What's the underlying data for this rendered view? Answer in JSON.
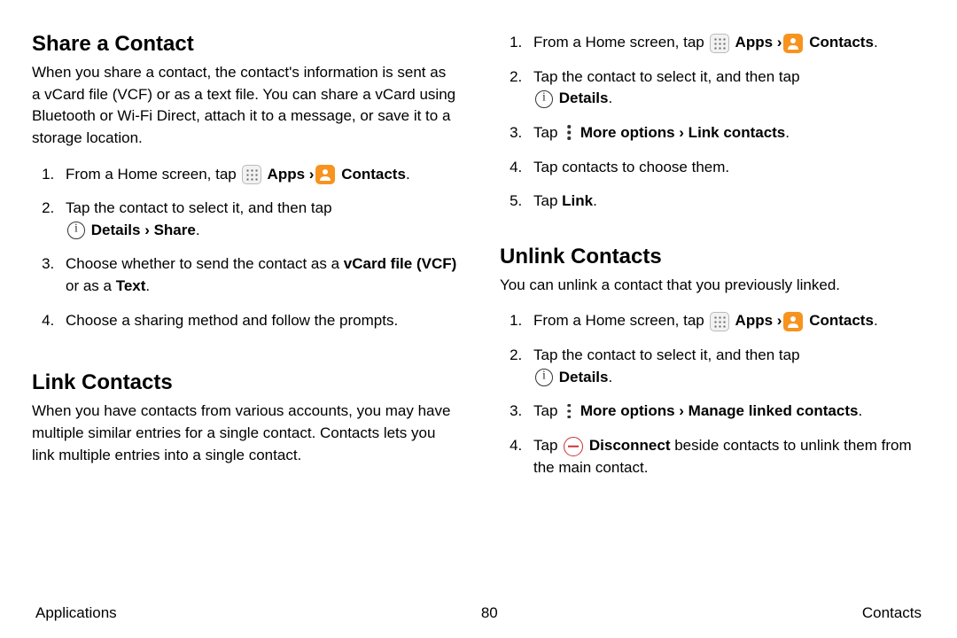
{
  "left": {
    "h1": "Share a Contact",
    "p1": "When you share a contact, the contact's information is sent as a vCard file (VCF) or as a text file. You can share a vCard using Bluetooth or Wi-Fi Direct, attach it to a message, or save it to a storage location.",
    "s1": {
      "t1a": "From a Home screen, tap ",
      "apps": " Apps ",
      "chev": "›",
      "contacts": " Contacts",
      "dot": ".",
      "t2a": "Tap the contact to select it, and then tap ",
      "details_share": " Details › Share",
      "t3a": "Choose whether to send the contact as a ",
      "vcf": "vCard file (VCF)",
      "t3b": " or as a ",
      "text": "Text",
      "t4": "Choose a sharing method and follow the prompts."
    },
    "h2": "Link Contacts",
    "p2": "When you have contacts from various accounts, you may have multiple similar entries for a single contact. Contacts lets you link multiple entries into a single contact."
  },
  "right": {
    "s2": {
      "t1a": "From a Home screen, tap ",
      "apps": " Apps ",
      "chev": "›",
      "contacts": " Contacts",
      "dot": ".",
      "t2a": "Tap the contact to select it, and then tap ",
      "details": " Details",
      "t3a": "Tap ",
      "more_link": " More options › Link contacts",
      "t4": "Tap contacts to choose them.",
      "t5a": "Tap ",
      "link": "Link"
    },
    "h3": "Unlink Contacts",
    "p3": "You can unlink a contact that you previously linked.",
    "s3": {
      "t1a": "From a Home screen, tap ",
      "apps": " Apps ",
      "chev": "›",
      "contacts": " Contacts",
      "dot": ".",
      "t2a": "Tap the contact to select it, and then tap ",
      "details": " Details",
      "t3a": "Tap ",
      "more_manage": " More options › Manage linked contacts",
      "t4a": "Tap ",
      "disconnect": " Disconnect",
      "t4b": " beside contacts to unlink them from the main contact."
    }
  },
  "footer": {
    "left": "Applications",
    "center": "80",
    "right": "Contacts"
  }
}
